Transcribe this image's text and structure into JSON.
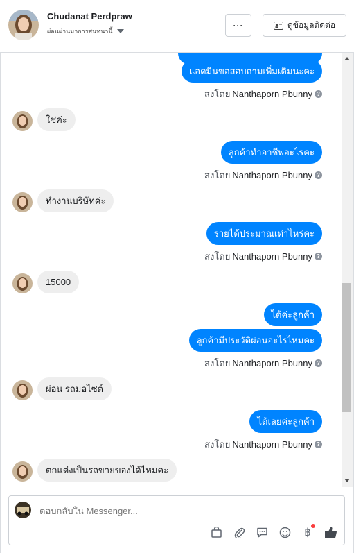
{
  "header": {
    "name": "Chudanat Perdpraw",
    "subtitle": "ผ่อนผ่านมาการสนทนานี้",
    "more_label": "···",
    "contact_label": "ดูข้อมูลติดต่อ"
  },
  "messages": {
    "m0": "แอดมินขอสอบถามเพิ่มเติมนะคะ",
    "m1": "ใช่ค่ะ",
    "m2": "ลูกค้าทำอาชีพอะไรคะ",
    "m3": "ทำงานบริษัทค่ะ",
    "m4": "รายได้ประมาณเท่าไหร่คะ",
    "m5": "15000",
    "m6": "ได้ค่ะลูกค้า",
    "m7": "ลูกค้ามีประวัติผ่อนอะไรไหมคะ",
    "m8": "ผ่อน รถมอไซต์",
    "m9": "ได้เลยค่ะลูกค้า",
    "m10": "ตกแต่งเป็นรถขายของได้ไหมคะ"
  },
  "sent_by": {
    "prefix": "ส่งโดย",
    "name": "Nanthaporn Pbunny"
  },
  "composer": {
    "placeholder": "ตอบกลับใน Messenger..."
  },
  "colors": {
    "outgoing": "#0084ff",
    "incoming": "#eeeeee"
  },
  "icons": [
    "bag-icon",
    "attachment-icon",
    "saved-replies-icon",
    "emoji-icon",
    "payment-icon",
    "like-icon"
  ]
}
